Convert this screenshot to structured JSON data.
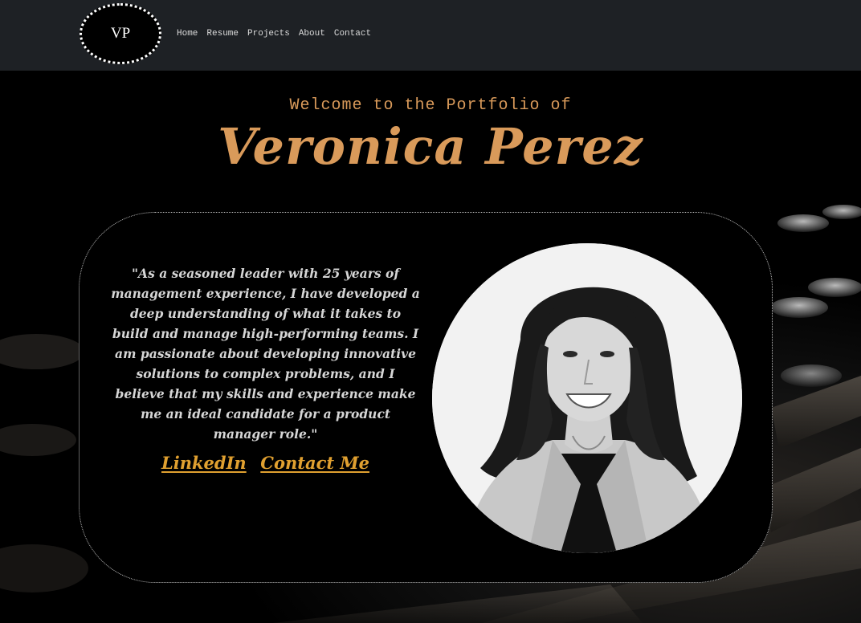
{
  "header": {
    "logo_text": "VP",
    "nav": [
      {
        "label": "Home"
      },
      {
        "label": "Resume"
      },
      {
        "label": "Projects"
      },
      {
        "label": "About"
      },
      {
        "label": "Contact"
      }
    ]
  },
  "hero": {
    "welcome": "Welcome to the Portfolio of",
    "name": "Veronica Perez"
  },
  "card": {
    "quote": "\"As a seasoned leader with 25 years of management experience, I have developed a deep understanding of what it takes to build and manage high-performing teams. I am passionate about developing innovative solutions to complex problems, and I believe that my skills and experience make me an ideal candidate for a product manager role.\"",
    "links": {
      "linkedin": "LinkedIn",
      "contact": "Contact Me"
    }
  },
  "colors": {
    "accent": "#d99a5a",
    "link": "#e0a030",
    "navbar": "#1e2125",
    "background": "#000000"
  }
}
